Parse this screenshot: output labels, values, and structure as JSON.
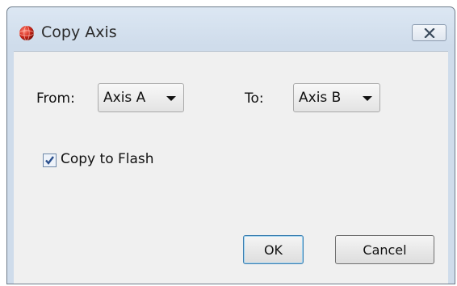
{
  "window": {
    "title": "Copy Axis",
    "icon": "app-sphere-icon",
    "close_icon": "close-x-icon"
  },
  "form": {
    "from_label": "From:",
    "from_value": "Axis A",
    "to_label": "To:",
    "to_value": "Axis B",
    "copy_to_flash_label": "Copy to Flash",
    "copy_to_flash_checked": true
  },
  "buttons": {
    "ok_label": "OK",
    "cancel_label": "Cancel"
  },
  "colors": {
    "icon_red": "#cc2a1e",
    "check_blue": "#2a4f8c"
  }
}
